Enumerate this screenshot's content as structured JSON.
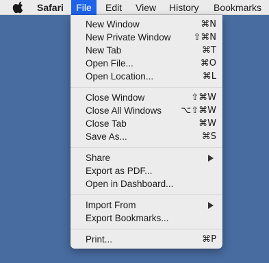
{
  "menubar": {
    "app_name": "Safari",
    "items": [
      "File",
      "Edit",
      "View",
      "History",
      "Bookmarks"
    ],
    "active_item": "File"
  },
  "file_menu": {
    "groups": [
      [
        {
          "label": "New Window",
          "shortcut": "⌘N"
        },
        {
          "label": "New Private Window",
          "shortcut": "⇧⌘N"
        },
        {
          "label": "New Tab",
          "shortcut": "⌘T"
        },
        {
          "label": "Open File...",
          "shortcut": "⌘O"
        },
        {
          "label": "Open Location...",
          "shortcut": "⌘L"
        }
      ],
      [
        {
          "label": "Close Window",
          "shortcut": "⇧⌘W"
        },
        {
          "label": "Close All Windows",
          "shortcut": "⌥⇧⌘W"
        },
        {
          "label": "Close Tab",
          "shortcut": "⌘W"
        },
        {
          "label": "Save As...",
          "shortcut": "⌘S"
        }
      ],
      [
        {
          "label": "Share",
          "submenu": true
        },
        {
          "label": "Export as PDF..."
        },
        {
          "label": "Open in Dashboard..."
        }
      ],
      [
        {
          "label": "Import From",
          "submenu": true
        },
        {
          "label": "Export Bookmarks..."
        }
      ],
      [
        {
          "label": "Print...",
          "shortcut": "⌘P"
        }
      ]
    ]
  },
  "colors": {
    "menubar_bg": "#ebebeb",
    "active_highlight": "#1e64ea",
    "desktop": "#486ca0",
    "menu_bg": "#ececec"
  }
}
